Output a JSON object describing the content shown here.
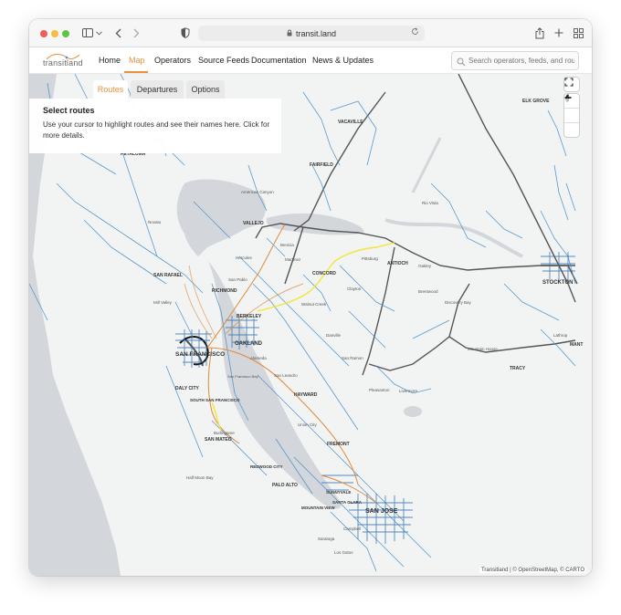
{
  "browser": {
    "url": "transit.land"
  },
  "nav": {
    "logo_text": "transitland",
    "links": [
      "Home",
      "Map",
      "Operators",
      "Source Feeds",
      "Documentation",
      "News & Updates"
    ],
    "active": "Map",
    "search_placeholder": "Search operators, feeds, and rou"
  },
  "panel": {
    "tabs": [
      "Routes",
      "Departures",
      "Options"
    ],
    "active_tab": "Routes",
    "title": "Select routes",
    "description": "Use your cursor to highlight routes and see their names here. Click for more details."
  },
  "map": {
    "attribution": "Transitland | © OpenStreetMap, © CARTO",
    "labels": {
      "elk_grove": "ELK GROVE",
      "vacaville": "VACAVILLE",
      "petaluma": "PETALUMA",
      "fairfield": "FAIRFIELD",
      "american_canyon": "American Canyon",
      "rio_vista": "Rio Vista",
      "vallejo": "VALLEJO",
      "novato": "Novato",
      "benicia": "Benicia",
      "hercules": "Hercules",
      "martinez": "Martinez",
      "pittsburg": "Pittsburg",
      "antioch": "ANTIOCH",
      "oakley": "Oakley",
      "san_rafael": "SAN RAFAEL",
      "san_pablo": "San Pablo",
      "concord": "CONCORD",
      "richmond": "RICHMOND",
      "clayton": "Clayton",
      "brentwood": "Brentwood",
      "stockton": "STOCKTON",
      "mill_valley": "Mill Valley",
      "walnut_creek": "Walnut Creek",
      "discovery_bay": "Discovery Bay",
      "berkeley": "BERKELEY",
      "oakland": "OAKLAND",
      "danville": "Danville",
      "lathrop": "Lathrop",
      "manteca": "MANT",
      "san_francisco": "SAN FRANCISCO",
      "alameda": "Alameda",
      "san_ramon": "San Ramon",
      "mountain_house": "Mountain House",
      "san_francisco_bay": "San Francisco Bay",
      "san_leandro": "San Leandro",
      "tracy": "TRACY",
      "daly_city": "DALY CITY",
      "hayward": "HAYWARD",
      "pleasanton": "Pleasanton",
      "livermore": "Livermore",
      "south_sf": "SOUTH SAN FRANCISCO",
      "union_city": "Union City",
      "burlingame": "Burlingame",
      "san_mateo": "SAN MATEO",
      "fremont": "FREMONT",
      "redwood_city": "REDWOOD CITY",
      "half_moon_bay": "Half Moon Bay",
      "palo_alto": "PALO ALTO",
      "mountain_view": "MOUNTAIN VIEW",
      "sunnyvale": "SUNNYVALE",
      "santa_clara": "SANTA CLARA",
      "san_jose": "SAN JOSE",
      "campbell": "Campbell",
      "saratoga": "Saratoga",
      "los_gatos": "Los Gatos"
    }
  },
  "colors": {
    "accent": "#e8913c",
    "route_blue": "#4a90c8",
    "rail_orange": "#e08a3a",
    "rail_yellow": "#f2e63a",
    "water": "#d3d6da",
    "land": "#f2f3f3"
  }
}
